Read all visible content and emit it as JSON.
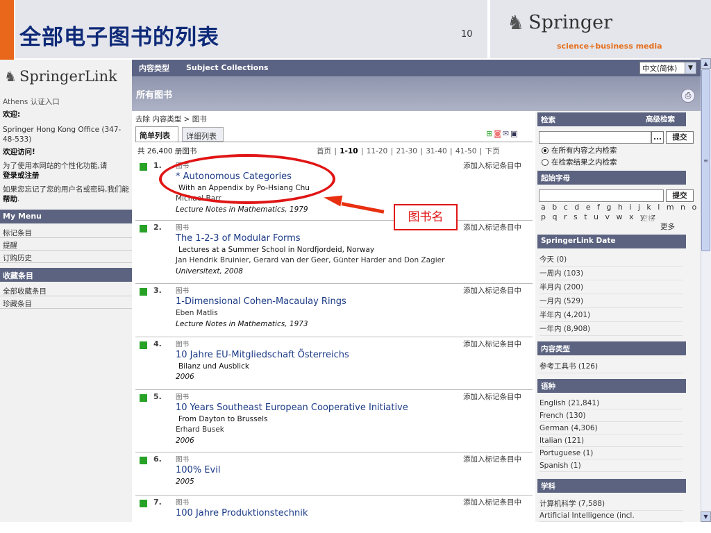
{
  "slide": {
    "title": "全部电子图书的列表",
    "page_number": "10"
  },
  "springer": {
    "name": "Springer",
    "tagline": "science+business media"
  },
  "sidebar": {
    "logo": "SpringerLink",
    "athens": "Athens 认证入口",
    "welcome_label": "欢迎:",
    "office": "Springer Hong Kong Office (347-48-533)",
    "welcome_visit": "欢迎访问!",
    "personal_text": "为了使用本网站的个性化功能,请",
    "login_register": "登录或注册",
    "forgot_text": "如果您忘记了您的用户名或密码,我们能",
    "help_link": "帮助",
    "my_menu": "My Menu",
    "menu_items": [
      "标记条目",
      "提醒",
      "订购历史"
    ],
    "collection_head": "收藏条目",
    "collection_items": [
      "全部收藏条目",
      "珍藏条目"
    ]
  },
  "nav": {
    "content_type": "内容类型",
    "subject_collections": "Subject Collections",
    "language": "中文(简体)",
    "section_title": "所有图书",
    "print_icon": "printer-icon"
  },
  "breadcrumb": "去除 内容类型 > 图书",
  "tabs": {
    "simple": "简单列表",
    "detail": "详细列表"
  },
  "results": {
    "count": "共 26,400 册图书",
    "pager": {
      "first": "首页",
      "current": "1-10",
      "pages": [
        "11-20",
        "21-30",
        "31-40",
        "41-50"
      ],
      "next": "下页"
    },
    "add_label": "添加入标记条目中",
    "items": [
      {
        "num": "1.",
        "type": "图书",
        "title": "* Autonomous Categories",
        "subtitle": "With an Appendix by Po-Hsiang Chu",
        "authors": "Michael Barr",
        "series": "Lecture Notes in Mathematics",
        "year": ", 1979"
      },
      {
        "num": "2.",
        "type": "图书",
        "title": "The 1-2-3 of Modular Forms",
        "subtitle": "Lectures at a Summer School in Nordfjordeid, Norway",
        "authors": "Jan Hendrik Bruinier, Gerard van der Geer, Günter Harder and Don Zagier",
        "series": "Universitext",
        "year": ", 2008"
      },
      {
        "num": "3.",
        "type": "图书",
        "title": "1-Dimensional Cohen-Macaulay Rings",
        "subtitle": "",
        "authors": "Eben Matlis",
        "series": "Lecture Notes in Mathematics",
        "year": ", 1973"
      },
      {
        "num": "4.",
        "type": "图书",
        "title": "10 Jahre EU-Mitgliedschaft Österreichs",
        "subtitle": "Bilanz und Ausblick",
        "authors": "",
        "series": "",
        "year": "2006"
      },
      {
        "num": "5.",
        "type": "图书",
        "title": "10 Years Southeast European Cooperative Initiative",
        "subtitle": "From Dayton to Brussels",
        "authors": "Erhard Busek",
        "series": "",
        "year": "2006"
      },
      {
        "num": "6.",
        "type": "图书",
        "title": "100% Evil",
        "subtitle": "",
        "authors": "",
        "series": "",
        "year": "2005"
      },
      {
        "num": "7.",
        "type": "图书",
        "title": "100 Jahre Produktionstechnik",
        "subtitle": "",
        "authors": "",
        "series": "",
        "year": ""
      }
    ]
  },
  "annotation": {
    "label": "图书名"
  },
  "right": {
    "search_head": "检索",
    "advanced": "高级检索",
    "ellipsis": "...",
    "submit": "提交",
    "radio_all": "在所有内容之内检索",
    "radio_results": "在检索结果之内检索",
    "start_char_head": "起始字母",
    "alpha_row1": "a b c d e f g h i j k l m n o",
    "alpha_row2": "p q r s t u v w x y z",
    "space": "空格",
    "more": "更多",
    "date_head": "SpringerLink Date",
    "date_items": [
      "今天 (0)",
      "一周内 (103)",
      "半月内 (200)",
      "一月内 (529)",
      "半年内 (4,201)",
      "一年内 (8,908)"
    ],
    "content_head": "内容类型",
    "content_items": [
      "参考工具书 (126)"
    ],
    "language_head": "语种",
    "language_items": [
      "English (21,841)",
      "French (130)",
      "German (4,306)",
      "Italian (121)",
      "Portuguese (1)",
      "Spanish (1)"
    ],
    "subject_head": "学科",
    "subject_items": [
      "计算机科学 (7,588)",
      "Artificial Intelligence (incl."
    ]
  }
}
